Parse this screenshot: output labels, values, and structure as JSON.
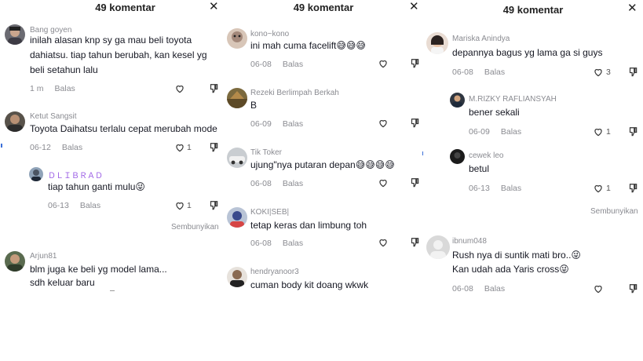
{
  "header": {
    "title": "49 komentar",
    "close_icon": "close-icon"
  },
  "left": {
    "c1": {
      "name": "Bang goyen",
      "lines": [
        "inilah alasan knp sy ga mau beli toyota",
        "dahiatsu. tiap tahun berubah, kan kesel yg",
        "beli setahun lalu"
      ],
      "time": "1 m",
      "reply": "Balas"
    },
    "c2": {
      "name": "Ketut Sangsit",
      "text": "Toyota Daihatsu terlalu cepat merubah mode",
      "date": "06-12",
      "reply": "Balas",
      "likes": "1"
    },
    "c3": {
      "name": "ＤＬＩＢＲＡＤ",
      "text": "tiap tahun ganti mulu😜",
      "date": "06-13",
      "reply": "Balas",
      "likes": "1"
    },
    "hide": "Sembunyikan",
    "c4": {
      "name": "Arjun81",
      "lines": [
        "blm juga ke beli yg model lama...",
        "sdh keluar baru"
      ]
    }
  },
  "middle": {
    "c1": {
      "name": "kono~kono",
      "text": "ini mah cuma facelift😅😅😅",
      "date": "06-08",
      "reply": "Balas"
    },
    "c2": {
      "name": "Rezeki Berlimpah Berkah",
      "text": "B",
      "date": "06-09",
      "reply": "Balas"
    },
    "c3": {
      "name": "Tik Toker",
      "text": "ujung\"nya putaran depan😅😅😅😅",
      "date": "06-08",
      "reply": "Balas"
    },
    "c4": {
      "name": "KOKI|SEB|",
      "text": "tetap keras dan limbung toh",
      "date": "06-08",
      "reply": "Balas"
    },
    "c5": {
      "name": "hendryanoor3",
      "text": "cuman body kit doang wkwk"
    }
  },
  "right": {
    "c1": {
      "name": "Mariska Anindya",
      "text": "depannya bagus yg lama ga si guys",
      "date": "06-08",
      "reply": "Balas",
      "likes": "3"
    },
    "c2": {
      "name": "M.RIZKY RAFLIANSYAH",
      "text": "bener sekali",
      "date": "06-09",
      "reply": "Balas",
      "likes": "1"
    },
    "c3": {
      "name": "cewek leo",
      "text": "betul",
      "date": "06-13",
      "reply": "Balas",
      "likes": "1"
    },
    "hide": "Sembunyikan",
    "c4": {
      "name": "ibnum048",
      "lines": [
        "Rush nya di suntik mati bro..😜",
        "Kan udah ada Yaris cross😜"
      ],
      "date": "06-08",
      "reply": "Balas"
    }
  },
  "colors": {
    "text": "#161823",
    "muted": "#8a8b91",
    "background": "#ffffff"
  }
}
